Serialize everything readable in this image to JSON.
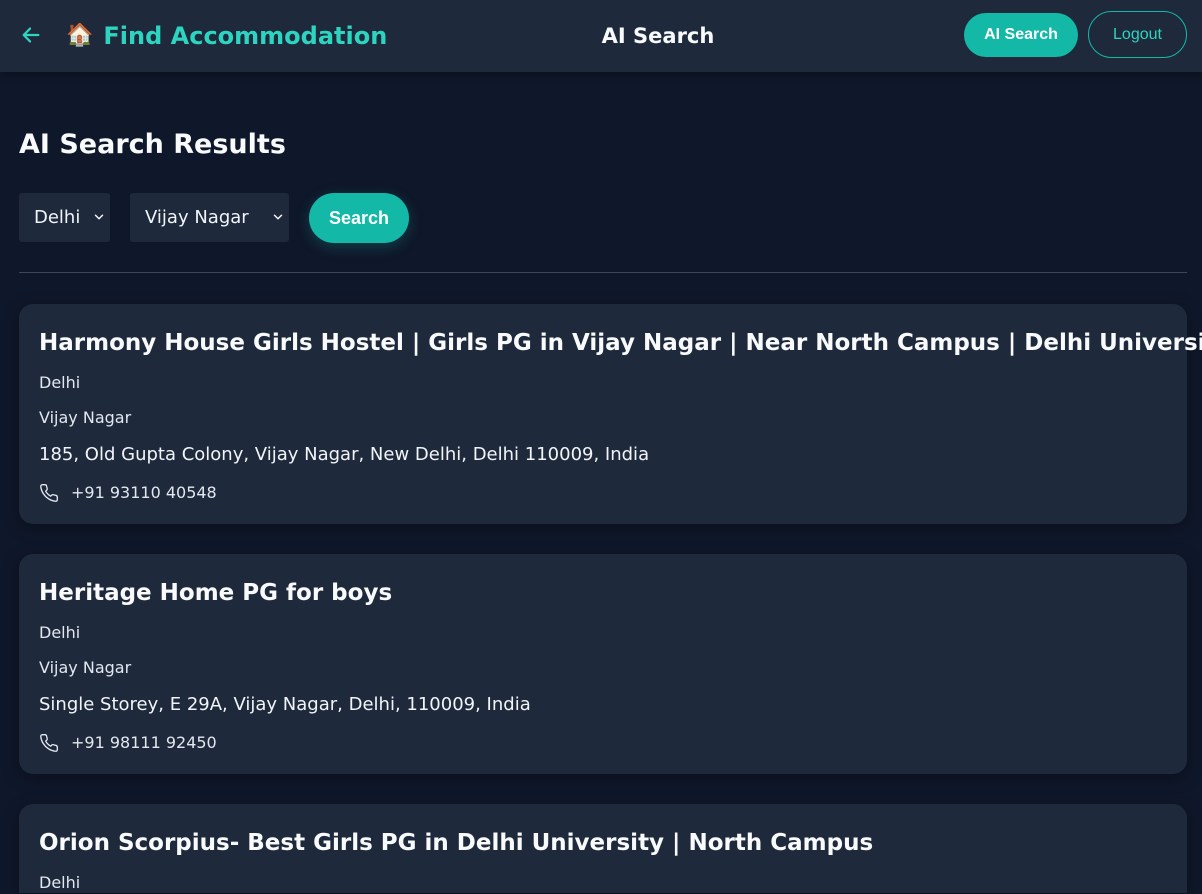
{
  "header": {
    "brand_emoji": "🏠",
    "brand_title": "Find Accommodation",
    "center_title": "AI Search",
    "ai_search_button": "AI Search",
    "logout_button": "Logout"
  },
  "main": {
    "heading": "AI Search Results",
    "filters": {
      "city_selected": "Delhi",
      "area_selected": "Vijay Nagar",
      "search_button": "Search"
    },
    "results": [
      {
        "title": "Harmony House Girls Hostel | Girls PG in Vijay Nagar | Near North Campus | Delhi University",
        "city": "Delhi",
        "area": "Vijay Nagar",
        "address": "185, Old Gupta Colony, Vijay Nagar, New Delhi, Delhi 110009, India",
        "phone": "+91 93110 40548"
      },
      {
        "title": "Heritage Home PG for boys",
        "city": "Delhi",
        "area": "Vijay Nagar",
        "address": "Single Storey, E 29A, Vijay Nagar, Delhi, 110009, India",
        "phone": "+91 98111 92450"
      },
      {
        "title": "Orion Scorpius- Best Girls PG in Delhi University | North Campus",
        "city": "Delhi"
      }
    ]
  },
  "colors": {
    "background": "#0f172a",
    "surface": "#1e293b",
    "accent": "#14b8a6",
    "accent_text": "#2dd4bf"
  },
  "icons": {
    "back": "arrow-left-icon",
    "brand": "house-icon",
    "select": "chevron-down-icon",
    "phone": "phone-icon"
  }
}
